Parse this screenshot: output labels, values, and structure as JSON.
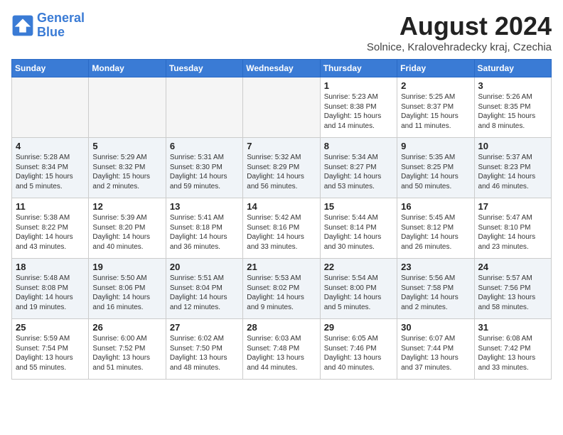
{
  "header": {
    "logo_line1": "General",
    "logo_line2": "Blue",
    "month_year": "August 2024",
    "location": "Solnice, Kralovehradecky kraj, Czechia"
  },
  "weekdays": [
    "Sunday",
    "Monday",
    "Tuesday",
    "Wednesday",
    "Thursday",
    "Friday",
    "Saturday"
  ],
  "weeks": [
    [
      {
        "day": "",
        "info": ""
      },
      {
        "day": "",
        "info": ""
      },
      {
        "day": "",
        "info": ""
      },
      {
        "day": "",
        "info": ""
      },
      {
        "day": "1",
        "info": "Sunrise: 5:23 AM\nSunset: 8:38 PM\nDaylight: 15 hours\nand 14 minutes."
      },
      {
        "day": "2",
        "info": "Sunrise: 5:25 AM\nSunset: 8:37 PM\nDaylight: 15 hours\nand 11 minutes."
      },
      {
        "day": "3",
        "info": "Sunrise: 5:26 AM\nSunset: 8:35 PM\nDaylight: 15 hours\nand 8 minutes."
      }
    ],
    [
      {
        "day": "4",
        "info": "Sunrise: 5:28 AM\nSunset: 8:34 PM\nDaylight: 15 hours\nand 5 minutes."
      },
      {
        "day": "5",
        "info": "Sunrise: 5:29 AM\nSunset: 8:32 PM\nDaylight: 15 hours\nand 2 minutes."
      },
      {
        "day": "6",
        "info": "Sunrise: 5:31 AM\nSunset: 8:30 PM\nDaylight: 14 hours\nand 59 minutes."
      },
      {
        "day": "7",
        "info": "Sunrise: 5:32 AM\nSunset: 8:29 PM\nDaylight: 14 hours\nand 56 minutes."
      },
      {
        "day": "8",
        "info": "Sunrise: 5:34 AM\nSunset: 8:27 PM\nDaylight: 14 hours\nand 53 minutes."
      },
      {
        "day": "9",
        "info": "Sunrise: 5:35 AM\nSunset: 8:25 PM\nDaylight: 14 hours\nand 50 minutes."
      },
      {
        "day": "10",
        "info": "Sunrise: 5:37 AM\nSunset: 8:23 PM\nDaylight: 14 hours\nand 46 minutes."
      }
    ],
    [
      {
        "day": "11",
        "info": "Sunrise: 5:38 AM\nSunset: 8:22 PM\nDaylight: 14 hours\nand 43 minutes."
      },
      {
        "day": "12",
        "info": "Sunrise: 5:39 AM\nSunset: 8:20 PM\nDaylight: 14 hours\nand 40 minutes."
      },
      {
        "day": "13",
        "info": "Sunrise: 5:41 AM\nSunset: 8:18 PM\nDaylight: 14 hours\nand 36 minutes."
      },
      {
        "day": "14",
        "info": "Sunrise: 5:42 AM\nSunset: 8:16 PM\nDaylight: 14 hours\nand 33 minutes."
      },
      {
        "day": "15",
        "info": "Sunrise: 5:44 AM\nSunset: 8:14 PM\nDaylight: 14 hours\nand 30 minutes."
      },
      {
        "day": "16",
        "info": "Sunrise: 5:45 AM\nSunset: 8:12 PM\nDaylight: 14 hours\nand 26 minutes."
      },
      {
        "day": "17",
        "info": "Sunrise: 5:47 AM\nSunset: 8:10 PM\nDaylight: 14 hours\nand 23 minutes."
      }
    ],
    [
      {
        "day": "18",
        "info": "Sunrise: 5:48 AM\nSunset: 8:08 PM\nDaylight: 14 hours\nand 19 minutes."
      },
      {
        "day": "19",
        "info": "Sunrise: 5:50 AM\nSunset: 8:06 PM\nDaylight: 14 hours\nand 16 minutes."
      },
      {
        "day": "20",
        "info": "Sunrise: 5:51 AM\nSunset: 8:04 PM\nDaylight: 14 hours\nand 12 minutes."
      },
      {
        "day": "21",
        "info": "Sunrise: 5:53 AM\nSunset: 8:02 PM\nDaylight: 14 hours\nand 9 minutes."
      },
      {
        "day": "22",
        "info": "Sunrise: 5:54 AM\nSunset: 8:00 PM\nDaylight: 14 hours\nand 5 minutes."
      },
      {
        "day": "23",
        "info": "Sunrise: 5:56 AM\nSunset: 7:58 PM\nDaylight: 14 hours\nand 2 minutes."
      },
      {
        "day": "24",
        "info": "Sunrise: 5:57 AM\nSunset: 7:56 PM\nDaylight: 13 hours\nand 58 minutes."
      }
    ],
    [
      {
        "day": "25",
        "info": "Sunrise: 5:59 AM\nSunset: 7:54 PM\nDaylight: 13 hours\nand 55 minutes."
      },
      {
        "day": "26",
        "info": "Sunrise: 6:00 AM\nSunset: 7:52 PM\nDaylight: 13 hours\nand 51 minutes."
      },
      {
        "day": "27",
        "info": "Sunrise: 6:02 AM\nSunset: 7:50 PM\nDaylight: 13 hours\nand 48 minutes."
      },
      {
        "day": "28",
        "info": "Sunrise: 6:03 AM\nSunset: 7:48 PM\nDaylight: 13 hours\nand 44 minutes."
      },
      {
        "day": "29",
        "info": "Sunrise: 6:05 AM\nSunset: 7:46 PM\nDaylight: 13 hours\nand 40 minutes."
      },
      {
        "day": "30",
        "info": "Sunrise: 6:07 AM\nSunset: 7:44 PM\nDaylight: 13 hours\nand 37 minutes."
      },
      {
        "day": "31",
        "info": "Sunrise: 6:08 AM\nSunset: 7:42 PM\nDaylight: 13 hours\nand 33 minutes."
      }
    ]
  ]
}
